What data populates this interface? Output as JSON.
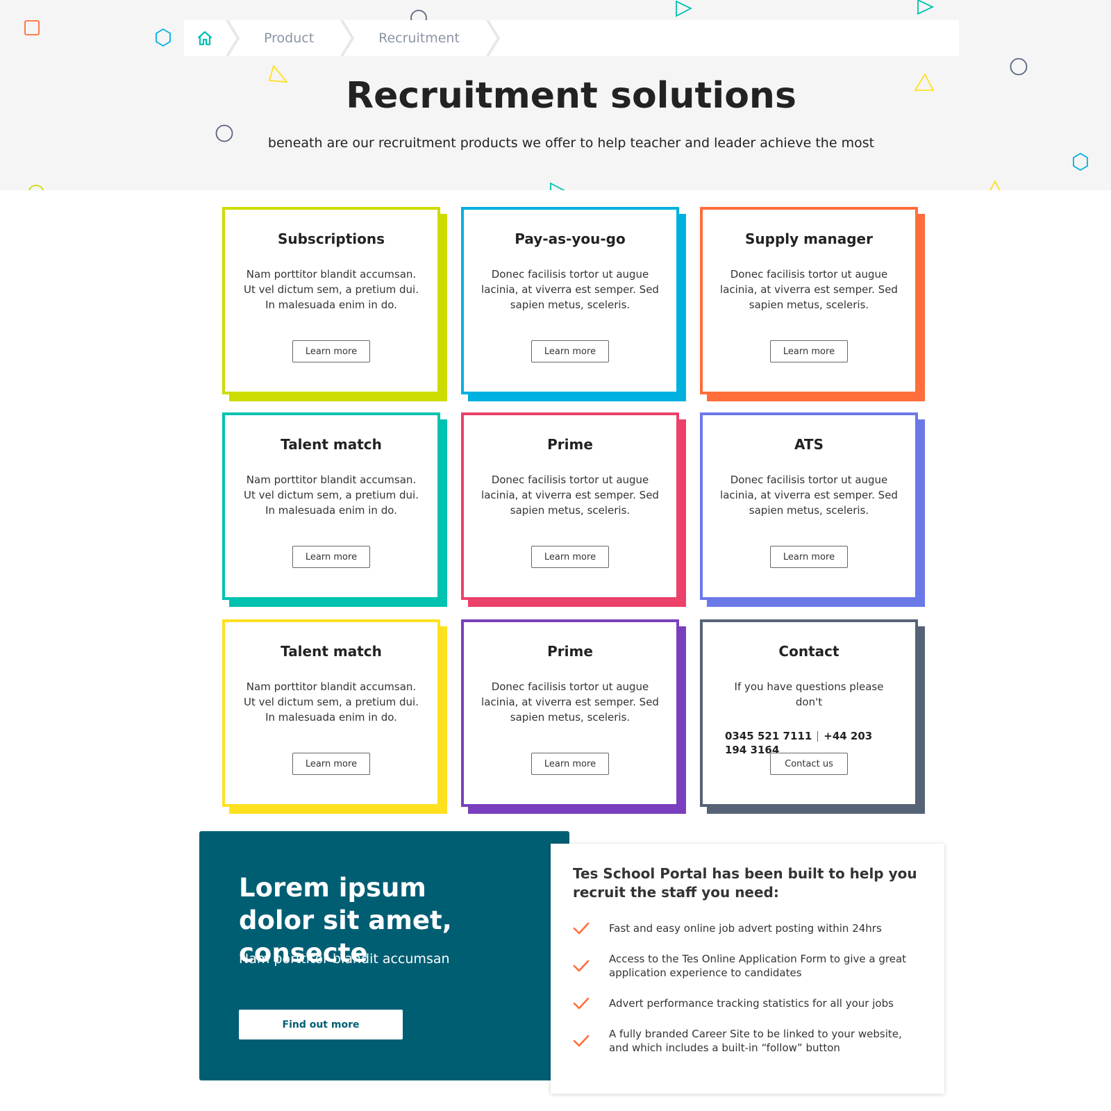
{
  "breadcrumb": {
    "home_icon": "home-icon",
    "items": [
      "Product",
      "Recruitment"
    ]
  },
  "hero": {
    "title": "Recruitment solutions",
    "subtitle": "beneath are our recruitment products we offer to help teacher and leader achieve the most"
  },
  "cards": [
    {
      "title": "Subscriptions",
      "text": "Nam porttitor blandit accumsan. Ut vel dictum sem, a pretium dui. In malesuada enim in do.",
      "button": "Learn more",
      "color": "#cddc00"
    },
    {
      "title": "Pay-as-you-go",
      "text": "Donec facilisis tortor ut augue lacinia, at viverra est semper. Sed sapien metus, sceleris.",
      "button": "Learn more",
      "color": "#00b0df"
    },
    {
      "title": "Supply manager",
      "text": "Donec facilisis tortor ut augue lacinia, at viverra est semper. Sed sapien metus, sceleris.",
      "button": "Learn more",
      "color": "#ff6d3a"
    },
    {
      "title": "Talent match",
      "text": "Nam porttitor blandit accumsan. Ut vel dictum sem, a pretium dui. In malesuada enim in do.",
      "button": "Learn more",
      "color": "#00c2b0"
    },
    {
      "title": "Prime",
      "text": "Donec facilisis tortor ut augue lacinia, at viverra est semper. Sed sapien metus, sceleris.",
      "button": "Learn more",
      "color": "#ec416a"
    },
    {
      "title": "ATS",
      "text": "Donec facilisis tortor ut augue lacinia, at viverra est semper. Sed sapien metus, sceleris.",
      "button": "Learn more",
      "color": "#6b78e8"
    },
    {
      "title": "Talent match",
      "text": "Nam porttitor blandit accumsan. Ut vel dictum sem, a pretium dui. In malesuada enim in do.",
      "button": "Learn more",
      "color": "#ffe01f"
    },
    {
      "title": "Prime",
      "text": "Donec facilisis tortor ut augue lacinia, at viverra est semper. Sed sapien metus, sceleris.",
      "button": "Learn more",
      "color": "#7a3fbe"
    }
  ],
  "contact": {
    "title": "Contact",
    "text": "If you have questions please don't",
    "phone1": "0345 521 7111",
    "phone2": "+44 203 194 3164",
    "button": "Contact us",
    "color": "#566377"
  },
  "promo": {
    "title": "Lorem ipsum dolor sit amet, consecte",
    "subtitle": "Nam porttitor blandit accumsan",
    "button": "Find out more",
    "color": "#005e73"
  },
  "info": {
    "title": "Tes School Portal has been built to help you recruit the staff you need:",
    "check_icon": "check-icon",
    "check_color": "#ff6d3a",
    "items": [
      "Fast and easy online job advert posting within 24hrs",
      "Access to the Tes Online Application Form to give a great application experience to candidates",
      "Advert performance tracking statistics for all your jobs",
      "A fully branded Career Site to be linked to your website, and which includes a built-in “follow” button"
    ]
  }
}
